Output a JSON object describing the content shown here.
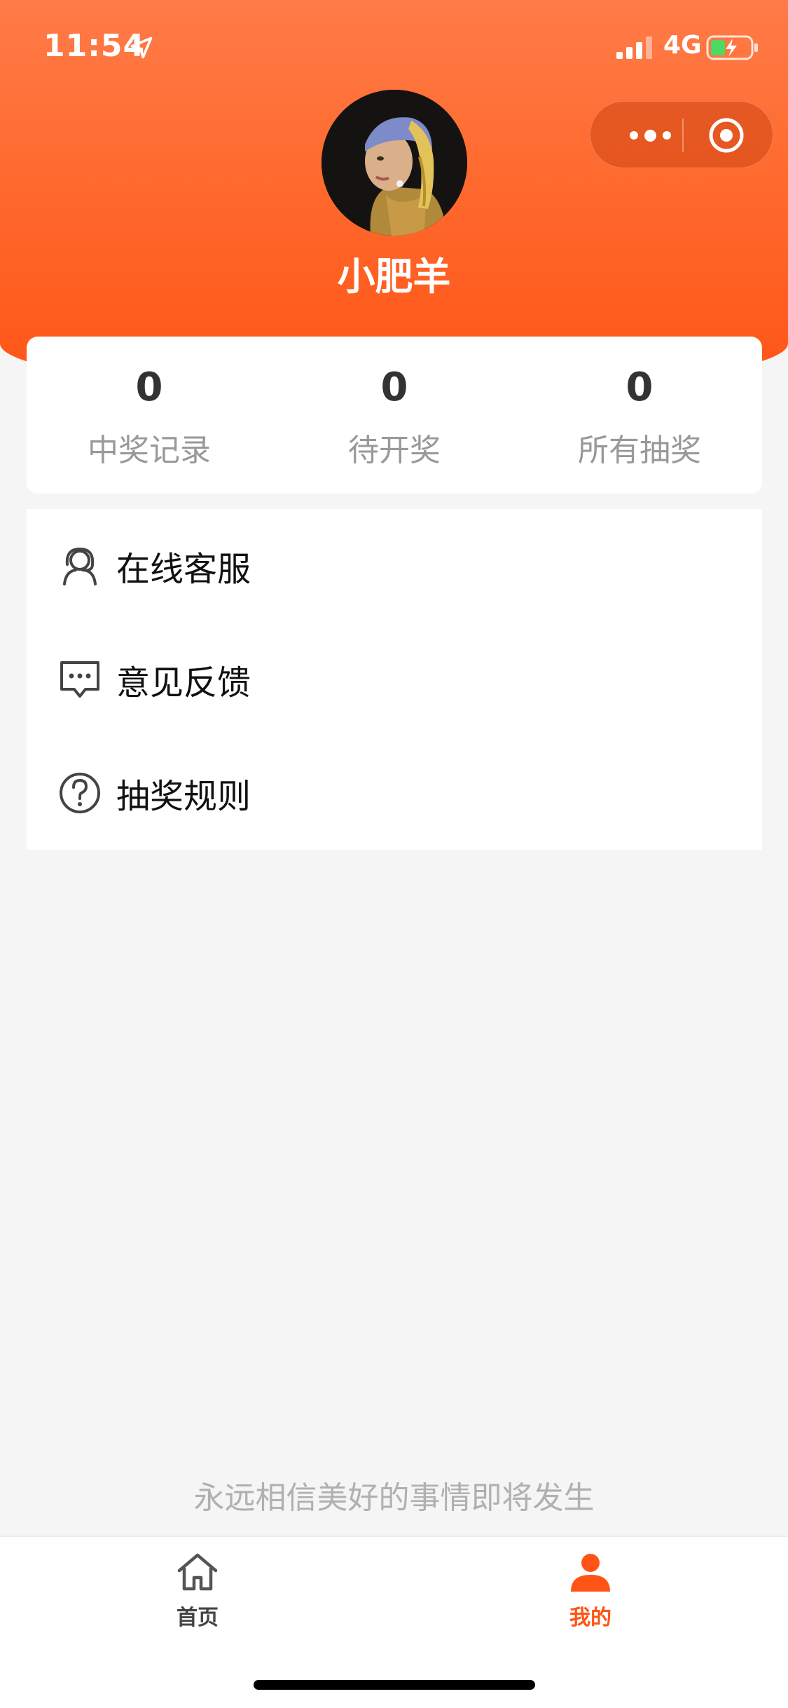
{
  "status_bar": {
    "time": "11:54",
    "network": "4G"
  },
  "capsule": {
    "more_icon": "more-dots-icon",
    "close_icon": "target-close-icon"
  },
  "profile": {
    "username": "小肥羊"
  },
  "stats": [
    {
      "value": "0",
      "label": "中奖记录"
    },
    {
      "value": "0",
      "label": "待开奖"
    },
    {
      "value": "0",
      "label": "所有抽奖"
    }
  ],
  "menu": [
    {
      "icon": "customer-service-icon",
      "label": "在线客服"
    },
    {
      "icon": "feedback-chat-icon",
      "label": "意见反馈"
    },
    {
      "icon": "question-circle-icon",
      "label": "抽奖规则"
    }
  ],
  "slogan": "永远相信美好的事情即将发生",
  "tabbar": {
    "home_label": "首页",
    "mine_label": "我的"
  },
  "colors": {
    "accent": "#ff5416",
    "header_top": "#ff7b48",
    "background": "#f5f5f5"
  }
}
